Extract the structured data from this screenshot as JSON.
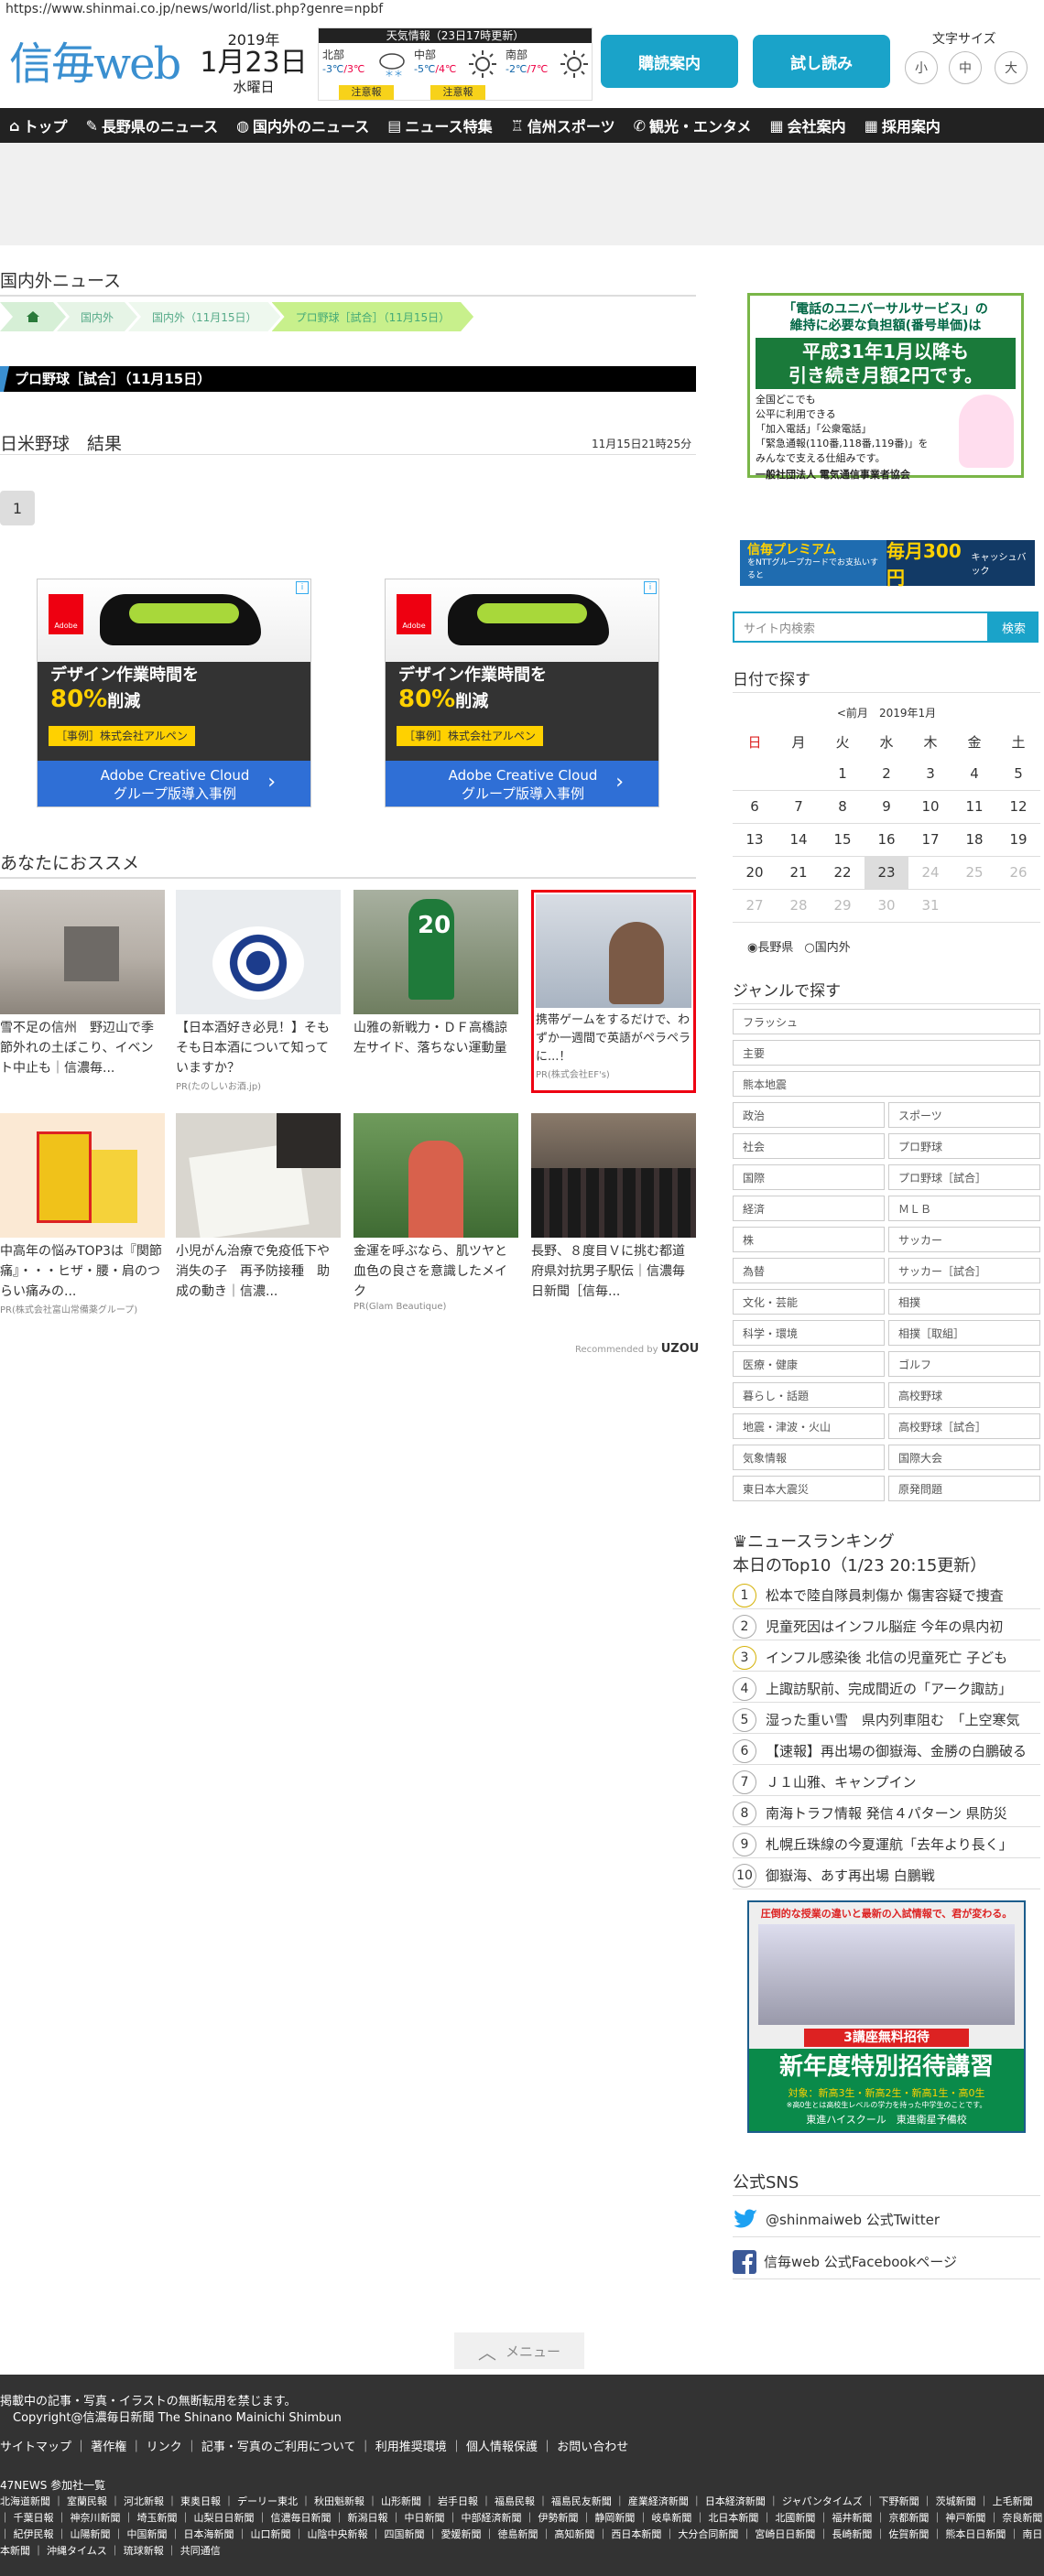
{
  "url": "https://www.shinmai.co.jp/news/world/list.php?genre=npbf",
  "logo": "信毎web",
  "date": {
    "year": "2019年",
    "md": "1月23日",
    "weekday": "水曜日"
  },
  "weather": {
    "header": "天気情報（23日17時更新）",
    "regions": [
      {
        "name": "北部",
        "low": "-3℃",
        "high": "3℃",
        "alert": "注意報"
      },
      {
        "name": "中部",
        "low": "-5℃",
        "high": "4℃",
        "alert": "注意報"
      },
      {
        "name": "南部",
        "low": "-2℃",
        "high": "7℃",
        "alert": ""
      }
    ]
  },
  "buttons": {
    "subscribe": "購読案内",
    "trial": "試し読み"
  },
  "font_size": {
    "label": "文字サイズ",
    "small": "小",
    "medium": "中",
    "large": "大"
  },
  "nav": [
    "トップ",
    "長野県のニュース",
    "国内外のニュース",
    "ニュース特集",
    "信州スポーツ",
    "観光・エンタメ",
    "会社案内",
    "採用案内"
  ],
  "section_title": "国内外ニュース",
  "breadcrumbs": [
    "国内外",
    "国内外（11月15日）",
    "プロ野球［試合］（11月15日）"
  ],
  "genre_bar": "プロ野球［試合］（11月15日）",
  "article": {
    "title": "日米野球　結果",
    "time": "11月15日21時25分"
  },
  "pager": "1",
  "ads": [
    {
      "headline": "デザイン作業時間を",
      "highlight": "80%",
      "after": "削減",
      "tag": "［事例］株式会社アルペン",
      "cta1": "Adobe Creative Cloud",
      "cta2": "グループ版導入事例",
      "brand": "Adobe"
    },
    {
      "headline": "デザイン作業時間を",
      "highlight": "80%",
      "after": "削減",
      "tag": "［事例］株式会社アルペン",
      "cta1": "Adobe Creative Cloud",
      "cta2": "グループ版導入事例",
      "brand": "Adobe"
    }
  ],
  "recommend_title": "あなたにおススメ",
  "recommend": [
    {
      "caption": "雪不足の信州　野辺山で季節外れの土ぼこり、イベント中止も｜信濃毎...",
      "pr": ""
    },
    {
      "caption": "【日本酒好き必見！】そもそも日本酒について知っていますか？",
      "pr": "PR(たのしいお酒.jp)"
    },
    {
      "caption": "山雅の新戦力・ＤＦ高橋諒　左サイド、落ちない運動量",
      "pr": ""
    },
    {
      "caption": "携帯ゲームをするだけで、わずか一週間で英語がペラペラに...！",
      "pr": "PR(株式会社EF's)"
    },
    {
      "caption": "中高年の悩みTOP3は『関節痛』・・・ヒザ・腰・肩のつらい痛みの...",
      "pr": "PR(株式会社富山常備薬グループ)"
    },
    {
      "caption": "小児がん治療で免疫低下や消失の子　再予防接種　助成の動き｜信濃...",
      "pr": ""
    },
    {
      "caption": "金運を呼ぶなら、肌ツヤと血色の良さを意識したメイク",
      "pr": "PR(Glam Beautique)"
    },
    {
      "caption": "長野、８度目Ｖに挑む都道府県対抗男子駅伝｜信濃毎日新聞［信毎...",
      "pr": ""
    }
  ],
  "recommended_by": "Recommended by",
  "uzou": "UZOU",
  "sidebar": {
    "ad1": {
      "l1": "「電話のユニバーサルサービス」の",
      "l2": "維持に必要な負担額(番号単価)は",
      "big1": "平成31年1月以降も",
      "big2": "引き続き月額2円です。",
      "b1": "全国どこでも",
      "b2": "公平に利用できる",
      "b3": "「加入電話」「公衆電話」",
      "b4": "「緊急通報(110番,118番,119番)」を",
      "b5": "みんなで支える仕組みです。",
      "org": "一般社団法人 電気通信事業者協会"
    },
    "ad2": {
      "left": "信毎プレミアム",
      "left2": "をNTTグループカードでお支払いすると",
      "right": "毎月300円",
      "right2": "キャッシュバック"
    },
    "search_placeholder": "サイト内検索",
    "search_button": "検索",
    "date_title": "日付で探す",
    "cal_prev": "<前月",
    "cal_month": "2019年1月",
    "weekdays": [
      "日",
      "月",
      "火",
      "水",
      "木",
      "金",
      "土"
    ],
    "cal_rows": [
      [
        "",
        "",
        "1",
        "2",
        "3",
        "4",
        "5"
      ],
      [
        "6",
        "7",
        "8",
        "9",
        "10",
        "11",
        "12"
      ],
      [
        "13",
        "14",
        "15",
        "16",
        "17",
        "18",
        "19"
      ],
      [
        "20",
        "21",
        "22",
        "23",
        "24",
        "25",
        "26"
      ],
      [
        "27",
        "28",
        "29",
        "30",
        "31",
        "",
        ""
      ]
    ],
    "radio": [
      "長野県",
      "国内外"
    ],
    "genre_title": "ジャンルで探す",
    "genres_full": [
      "フラッシュ",
      "主要",
      "熊本地震"
    ],
    "genres_pairs": [
      [
        "政治",
        "スポーツ"
      ],
      [
        "社会",
        "プロ野球"
      ],
      [
        "国際",
        "プロ野球［試合］"
      ],
      [
        "経済",
        "ＭＬＢ"
      ],
      [
        "株",
        "サッカー"
      ],
      [
        "為替",
        "サッカー［試合］"
      ],
      [
        "文化・芸能",
        "相撲"
      ],
      [
        "科学・環境",
        "相撲［取組］"
      ],
      [
        "医療・健康",
        "ゴルフ"
      ],
      [
        "暮らし・話題",
        "高校野球"
      ],
      [
        "地震・津波・火山",
        "高校野球［試合］"
      ],
      [
        "気象情報",
        "国際大会"
      ],
      [
        "東日本大震災",
        "原発問題"
      ]
    ],
    "ranking_title": "ニュースランキング",
    "ranking_sub": "本日のTop10（1/23 20:15更新）",
    "ranking": [
      "松本で陸自隊員刺傷か 傷害容疑で捜査",
      "児童死因はインフル脳症 今年の県内初",
      "インフル感染後 北信の児童死亡 子ども",
      "上諏訪駅前、完成間近の「アーク諏訪」",
      "湿った重い雪　県内列車阻む　「上空寒気",
      "【速報】再出場の御嶽海、金勝の白鵬破る",
      "Ｊ１山雅、キャンプイン",
      "南海トラフ情報 発信４パターン 県防災",
      "札幌丘珠線の今夏運航「去年より長く」",
      "御嶽海、あす再出場 白鵬戦"
    ],
    "ad3": {
      "top": "圧倒的な授業の違いと最新の入試情報で、君が変わる。",
      "banner": "3講座無料招待",
      "main": "新年度特別招待講習",
      "sub": "対象：新高3生・新高2生・新高1生・高0生",
      "sub2": "※高0生とは高校生レベルの学力を持った中学生のことです。",
      "brand1": "東進ハイスクール",
      "brand2": "東進衛星予備校"
    },
    "sns_title": "公式SNS",
    "sns": [
      "@shinmaiweb 公式Twitter",
      "信毎web 公式Facebookページ"
    ]
  },
  "menu": "メニュー",
  "footer": {
    "l1": "掲載中の記事・写真・イラストの無断転用を禁じます。",
    "l2": "Copyright@信濃毎日新聞 The Shinano Mainichi Shimbun",
    "links": [
      "サイトマップ",
      "著作権",
      "リンク",
      "記事・写真のご利用について",
      "利用推奨環境",
      "個人情報保護",
      "お問い合わせ"
    ],
    "p47": "47NEWS 参加社一覧",
    "papers": "北海道新聞 ｜ 室蘭民報 ｜ 河北新報 ｜ 東奥日報 ｜ デーリー東北 ｜ 秋田魁新報 ｜ 山形新聞 ｜ 岩手日報 ｜ 福島民報 ｜ 福島民友新聞 ｜ 産業経済新聞 ｜ 日本経済新聞 ｜ ジャパンタイムズ ｜ 下野新聞 ｜ 茨城新聞 ｜ 上毛新聞 ｜ 千葉日報 ｜ 神奈川新聞 ｜ 埼玉新聞 ｜ 山梨日日新聞 ｜ 信濃毎日新聞 ｜ 新潟日報 ｜ 中日新聞 ｜ 中部経済新聞 ｜ 伊勢新聞 ｜ 静岡新聞 ｜ 岐阜新聞 ｜ 北日本新聞 ｜ 北國新聞 ｜ 福井新聞 ｜ 京都新聞 ｜ 神戸新聞 ｜ 奈良新聞 ｜ 紀伊民報 ｜ 山陽新聞 ｜ 中国新聞 ｜ 日本海新聞 ｜ 山口新聞 ｜ 山陰中央新報 ｜ 四国新聞 ｜ 愛媛新聞 ｜ 徳島新聞 ｜ 高知新聞 ｜ 西日本新聞 ｜ 大分合同新聞 ｜ 宮崎日日新聞 ｜ 長崎新聞 ｜ 佐賀新聞 ｜ 熊本日日新聞 ｜ 南日本新聞 ｜ 沖縄タイムス ｜ 琉球新報 ｜ 共同通信"
  }
}
